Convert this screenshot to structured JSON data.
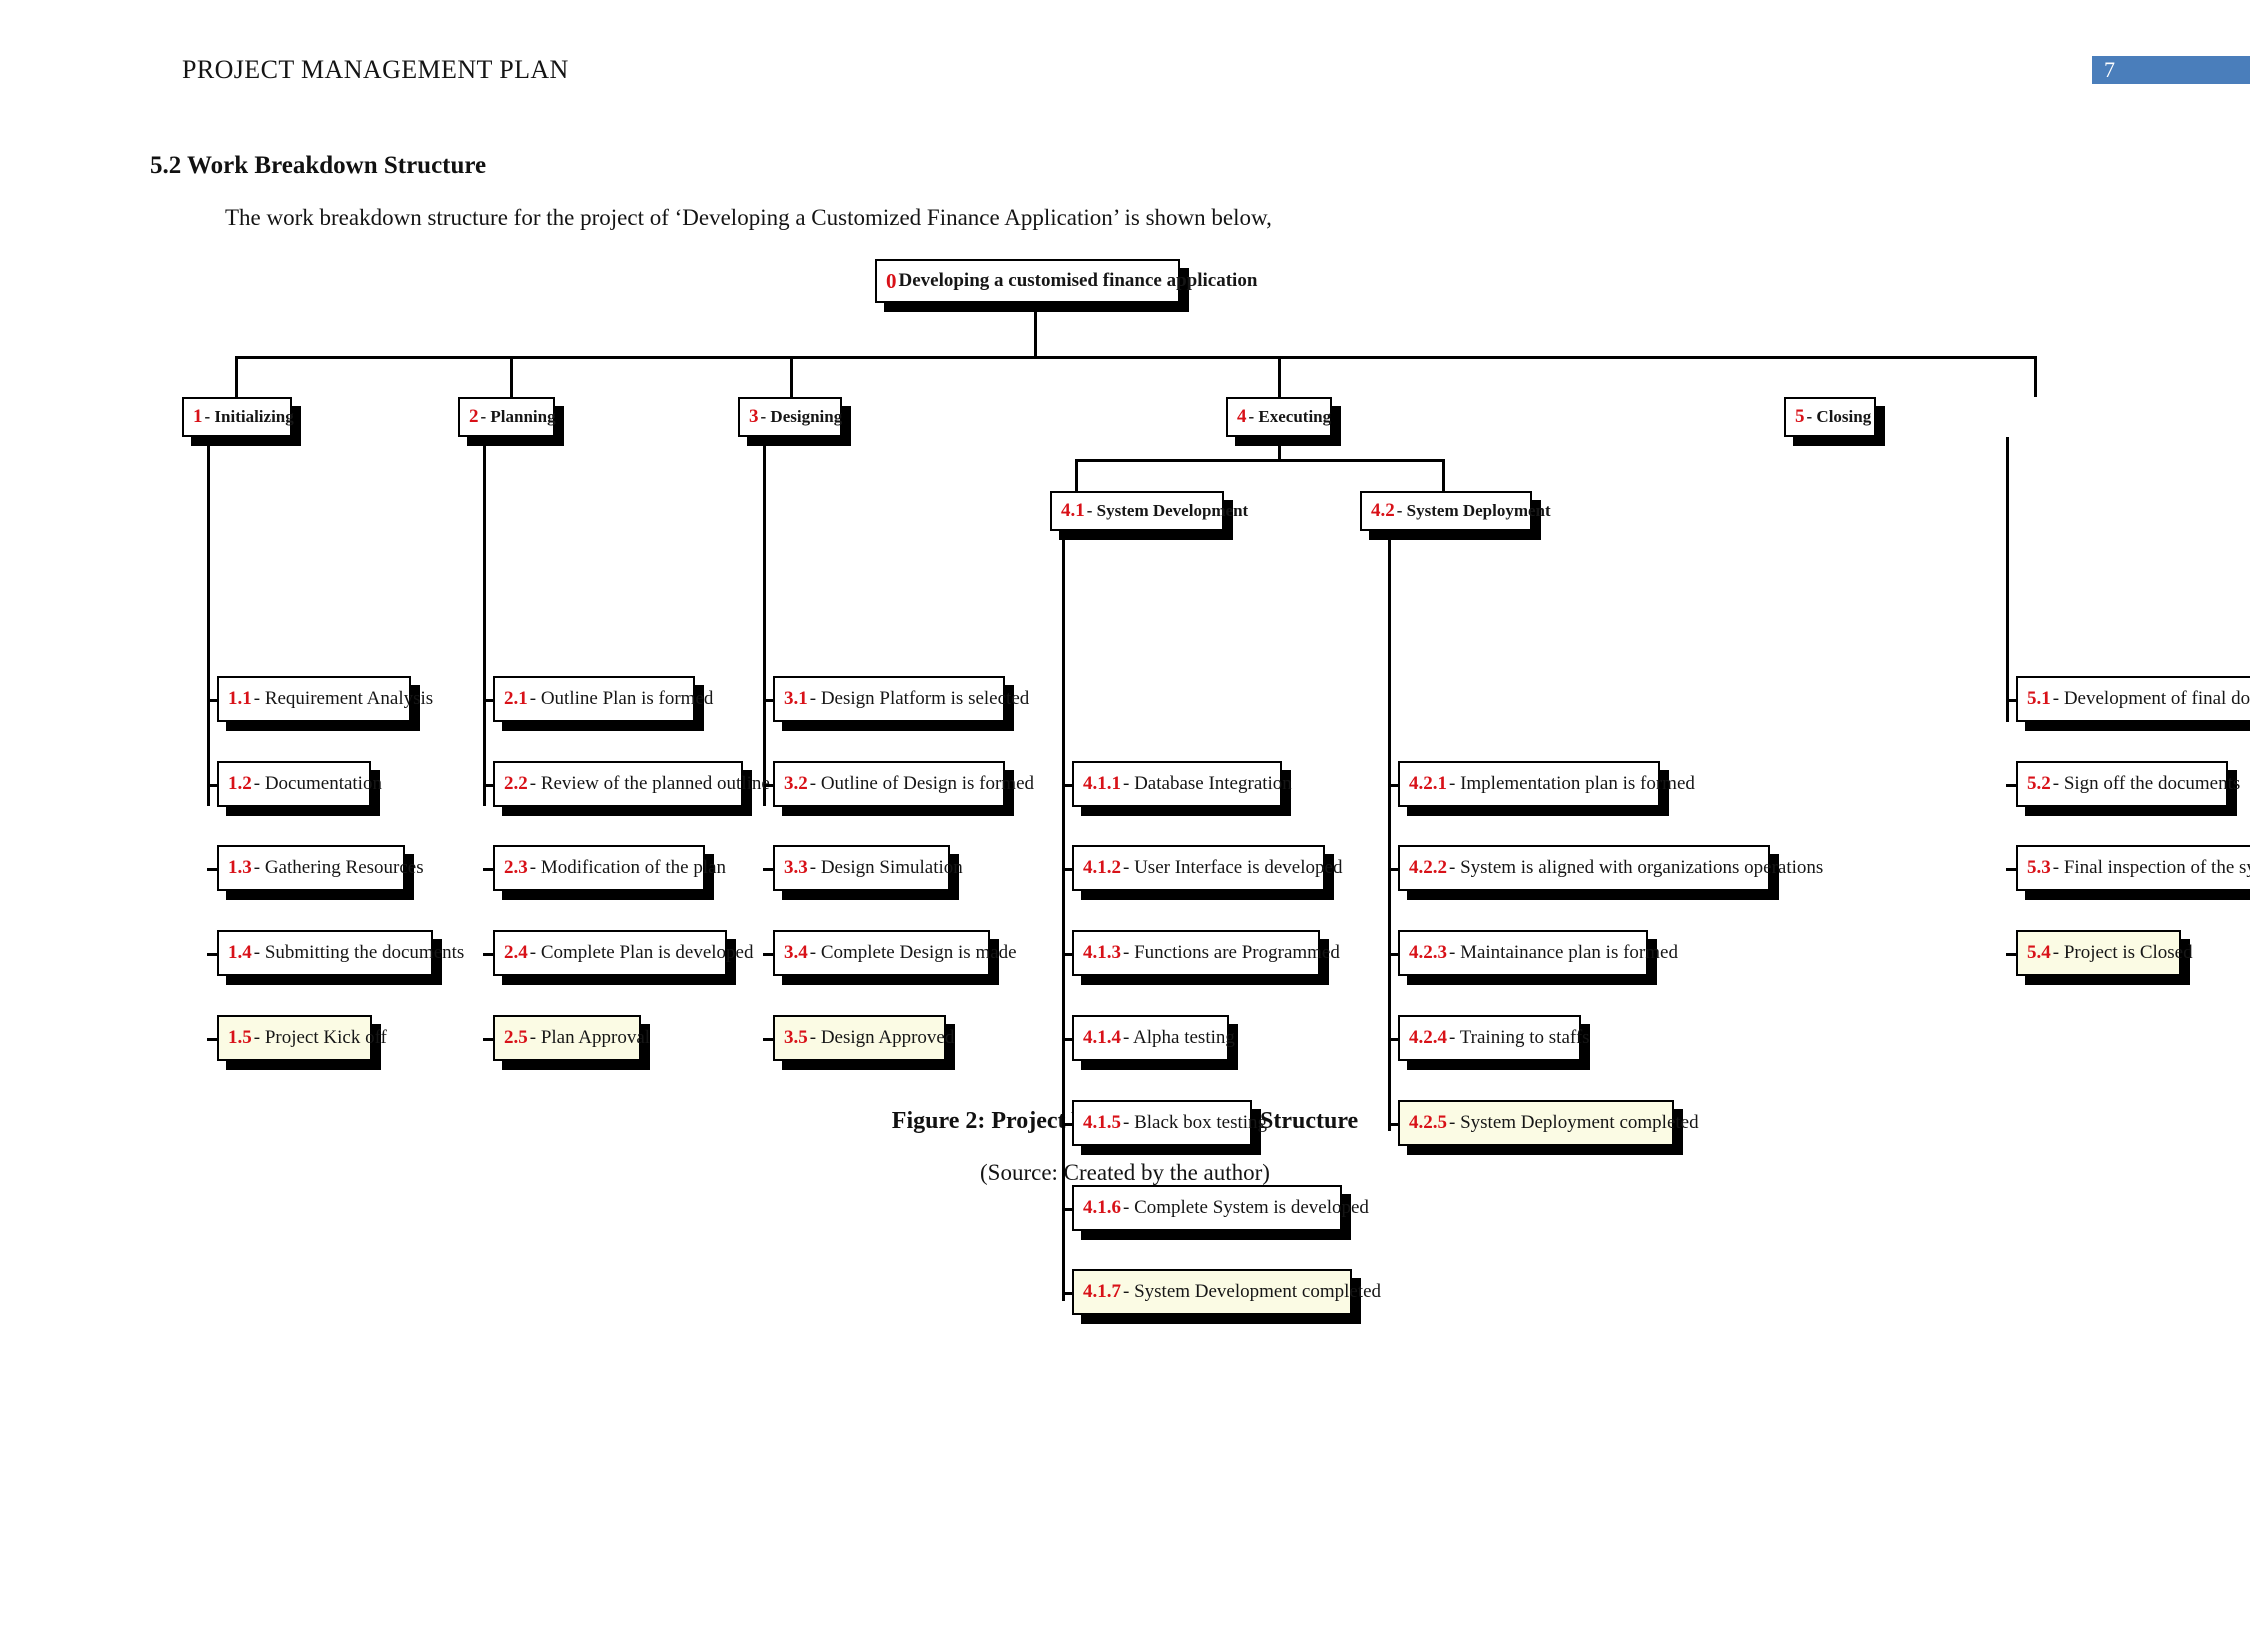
{
  "header": {
    "title": "PROJECT MANAGEMENT PLAN",
    "page_number": "7",
    "badge_color": "#4a7ebb"
  },
  "section": {
    "heading": "5.2 Work Breakdown Structure",
    "intro": "The work breakdown structure for the project of ‘Developing a Customized Finance Application’ is shown below,"
  },
  "figure": {
    "caption": "Figure 2: Project Work Breakdown Structure",
    "source": "(Source: Created by the author)"
  },
  "colors": {
    "node_id_red": "#d81118",
    "milestone_fill": "#fbfbe4",
    "node_fill": "#ffffff",
    "border": "#000000"
  },
  "chart_data": {
    "type": "diagram",
    "title": "Project Work Breakdown Structure",
    "root": {
      "id": "0",
      "label": "Developing a customised finance application"
    },
    "nodes": {
      "root": {
        "id": "0",
        "label": "Developing a customised finance application",
        "milestone": false
      },
      "l1_1": {
        "id": "1",
        "label": "- Initializing",
        "milestone": false
      },
      "l1_2": {
        "id": "2",
        "label": "- Planning",
        "milestone": false
      },
      "l1_3": {
        "id": "3",
        "label": "- Designing",
        "milestone": false
      },
      "l1_4": {
        "id": "4",
        "label": "- Executing",
        "milestone": false
      },
      "l1_5": {
        "id": "5",
        "label": "- Closing",
        "milestone": false
      },
      "n11": {
        "id": "1.1",
        "label": "- Requirement Analysis",
        "milestone": false
      },
      "n12": {
        "id": "1.2",
        "label": "- Documentation",
        "milestone": false
      },
      "n13": {
        "id": "1.3",
        "label": "- Gathering Resources",
        "milestone": false
      },
      "n14": {
        "id": "1.4",
        "label": "- Submitting the documents",
        "milestone": false
      },
      "n15": {
        "id": "1.5",
        "label": "- Project Kick off",
        "milestone": true
      },
      "n21": {
        "id": "2.1",
        "label": "- Outline Plan is formed",
        "milestone": false
      },
      "n22": {
        "id": "2.2",
        "label": "- Review of the planned outline",
        "milestone": false
      },
      "n23": {
        "id": "2.3",
        "label": "- Modification of the plan",
        "milestone": false
      },
      "n24": {
        "id": "2.4",
        "label": "- Complete Plan is developed",
        "milestone": false
      },
      "n25": {
        "id": "2.5",
        "label": "- Plan Approval",
        "milestone": true
      },
      "n31": {
        "id": "3.1",
        "label": "- Design Platform is selected",
        "milestone": false
      },
      "n32": {
        "id": "3.2",
        "label": "- Outline of Design is formed",
        "milestone": false
      },
      "n33": {
        "id": "3.3",
        "label": "- Design Simulation",
        "milestone": false
      },
      "n34": {
        "id": "3.4",
        "label": "- Complete Design is made",
        "milestone": false
      },
      "n35": {
        "id": "3.5",
        "label": "- Design Approved",
        "milestone": true
      },
      "n41": {
        "id": "4.1",
        "label": "- System Development",
        "milestone": false
      },
      "n42": {
        "id": "4.2",
        "label": "- System Deployment",
        "milestone": false
      },
      "n411": {
        "id": "4.1.1",
        "label": "- Database Integration",
        "milestone": false
      },
      "n412": {
        "id": "4.1.2",
        "label": "- User Interface is developed",
        "milestone": false
      },
      "n413": {
        "id": "4.1.3",
        "label": "- Functions are Programmed",
        "milestone": false
      },
      "n414": {
        "id": "4.1.4",
        "label": "- Alpha testing",
        "milestone": false
      },
      "n415": {
        "id": "4.1.5",
        "label": "- Black box testing",
        "milestone": false
      },
      "n416": {
        "id": "4.1.6",
        "label": "- Complete System is developed",
        "milestone": false
      },
      "n417": {
        "id": "4.1.7",
        "label": "- System Development completed",
        "milestone": true
      },
      "n421": {
        "id": "4.2.1",
        "label": "- Implementation plan is formed",
        "milestone": false
      },
      "n422": {
        "id": "4.2.2",
        "label": "- System is aligned with organizations operations",
        "milestone": false
      },
      "n423": {
        "id": "4.2.3",
        "label": "- Maintainance plan is formed",
        "milestone": false
      },
      "n424": {
        "id": "4.2.4",
        "label": "- Training to staffs",
        "milestone": false
      },
      "n425": {
        "id": "4.2.5",
        "label": "- System Deployment completed",
        "milestone": true
      },
      "n51": {
        "id": "5.1",
        "label": "- Development of final documents",
        "milestone": false
      },
      "n52": {
        "id": "5.2",
        "label": "- Sign off the documents",
        "milestone": false
      },
      "n53": {
        "id": "5.3",
        "label": "- Final inspection of the system",
        "milestone": false
      },
      "n54": {
        "id": "5.4",
        "label": "- Project is Closed",
        "milestone": true
      }
    }
  }
}
